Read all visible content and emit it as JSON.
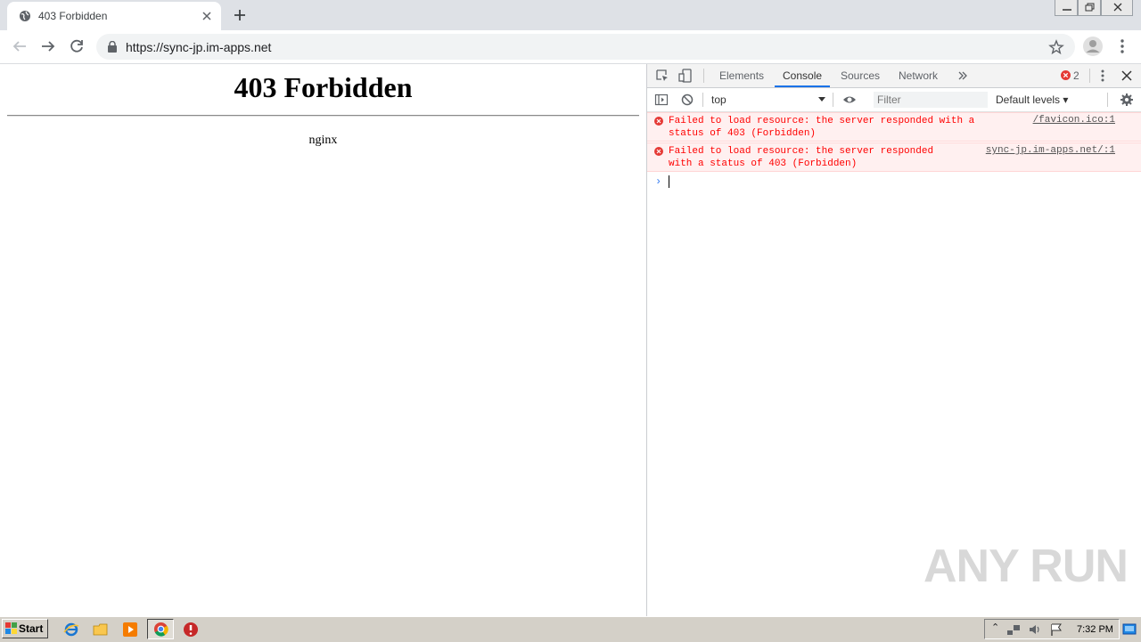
{
  "browser": {
    "tab_title": "403 Forbidden",
    "url": "https://sync-jp.im-apps.net"
  },
  "page": {
    "heading": "403 Forbidden",
    "server": "nginx"
  },
  "devtools": {
    "tabs": [
      "Elements",
      "Console",
      "Sources",
      "Network"
    ],
    "active_tab": "Console",
    "error_count": "2",
    "context": "top",
    "filter_placeholder": "Filter",
    "levels": "Default levels",
    "messages": [
      {
        "text": "Failed to load resource: the server responded with a\nstatus of 403 (Forbidden)",
        "source": "/favicon.ico:1"
      },
      {
        "text": "Failed to load resource: the server responded\nwith a status of 403 (Forbidden)",
        "source": "sync-jp.im-apps.net/:1"
      }
    ],
    "prompt": "›"
  },
  "watermark": "ANY RUN",
  "taskbar": {
    "start_label": "Start",
    "clock": "7:32 PM"
  },
  "colors": {
    "error_red": "#ff0000",
    "error_bg": "#fff0f0",
    "active_tab_blue": "#1a73e8",
    "taskbar_gray": "#d4d0c8"
  }
}
